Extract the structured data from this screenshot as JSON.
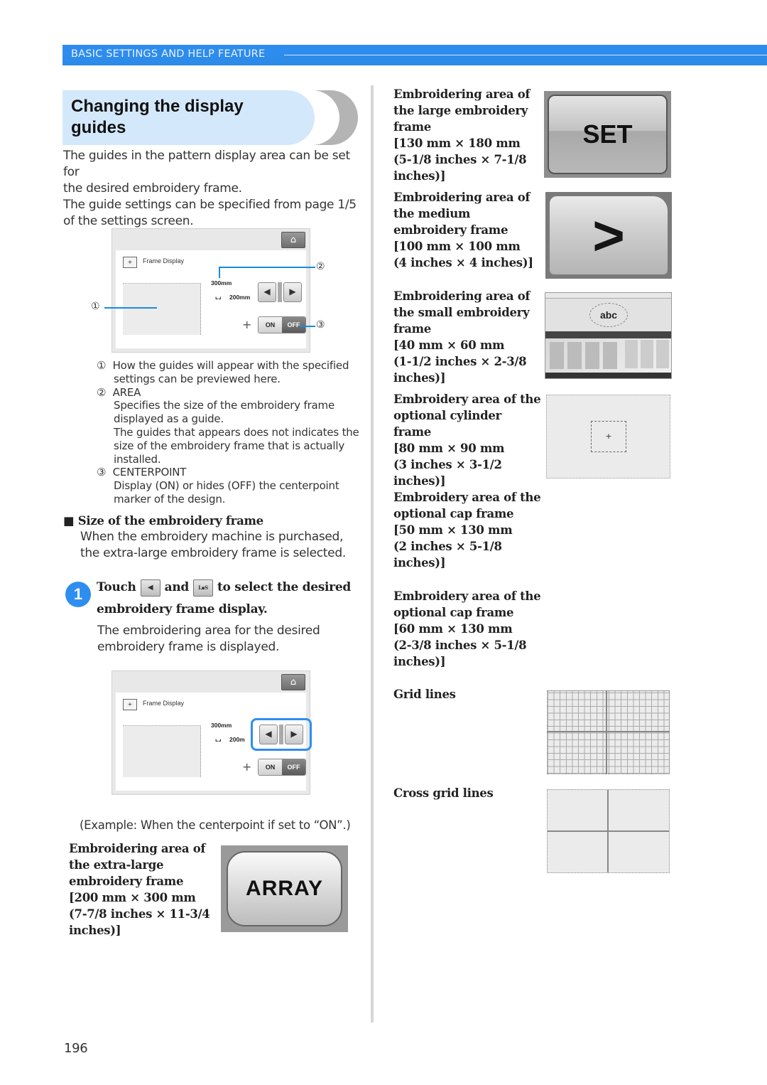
{
  "header": {
    "section": "BASIC SETTINGS AND HELP FEATURE"
  },
  "title": {
    "line1": "Changing the display",
    "line2": "guides"
  },
  "intro": [
    "The guides in the pattern display area can be set for",
    "the desired embroidery frame.",
    "The guide settings can be specified from page 1/5",
    "of the settings screen."
  ],
  "screen1": {
    "home_icon": "home-icon",
    "frame_display_label": "Frame Display",
    "width_label": "300mm",
    "height_label": "200mm",
    "left_arrow": "◀",
    "right_arrow": "▶",
    "plus": "+",
    "on_label": "ON",
    "off_label": "OFF",
    "callout1": "①",
    "callout2": "②",
    "callout3": "③"
  },
  "legend": [
    {
      "num": "①",
      "lines": [
        "How the guides will appear with the specified",
        "settings can be previewed here."
      ]
    },
    {
      "num": "②",
      "lines": [
        "AREA",
        "Specifies the size of the embroidery frame",
        "displayed as a guide.",
        "The guides that appears does not indicates the",
        "size of the embroidery frame that is actually",
        "installed."
      ]
    },
    {
      "num": "③",
      "lines": [
        "CENTERPOINT",
        "Display (ON) or hides (OFF) the centerpoint",
        "marker of the design."
      ]
    }
  ],
  "size_section": {
    "bullet": "■",
    "heading": "Size of the embroidery frame",
    "lines": [
      "When the embroidery machine is purchased,",
      "the extra-large embroidery frame is selected."
    ]
  },
  "step1": {
    "number": "1",
    "touch": "Touch",
    "and": "and",
    "rest": "to select the desired",
    "line2": "embroidery frame display.",
    "icon1": "◀",
    "icon2": "L▪S",
    "desc": [
      "The embroidering area for the desired",
      "embroidery frame is displayed."
    ]
  },
  "screen2": {
    "frame_display_label": "Frame Display",
    "width_label": "300mm",
    "height_label": "200m",
    "left_arrow": "◀",
    "right_arrow": "▶",
    "plus": "+",
    "on_label": "ON",
    "off_label": "OFF"
  },
  "example_caption": "(Example: When the centerpoint if set to “ON”.)",
  "frames": [
    {
      "lines": [
        "Embroidering area of",
        "the extra-large",
        "embroidery frame",
        "[200 mm × 300 mm",
        "(7-7/8 inches × 11-3/4",
        "inches)]"
      ],
      "image_label": "ARRAY"
    },
    {
      "lines": [
        "Embroidering area of",
        "the large embroidery",
        "frame",
        "[130 mm × 180 mm",
        "(5-1/8 inches × 7-1/8",
        "inches)]"
      ],
      "image_label": "SET"
    },
    {
      "lines": [
        "Embroidering area of",
        "the medium",
        "embroidery frame",
        "[100 mm × 100 mm",
        "(4 inches × 4 inches)]"
      ],
      "image_label": ">"
    },
    {
      "lines": [
        "Embroidering area of",
        "the small embroidery",
        "frame",
        "[40 mm × 60 mm",
        "(1-1/2 inches × 2-3/8",
        "inches)]"
      ],
      "image_label": "abc"
    },
    {
      "lines": [
        "Embroidery area of the",
        "optional cylinder frame",
        "[80 mm × 90 mm",
        "(3 inches × 3-1/2",
        "inches)]"
      ],
      "image_label": "+"
    },
    {
      "lines": [
        "Embroidery area of the",
        "optional cap frame",
        "[50 mm × 130 mm",
        "(2 inches × 5-1/8",
        "inches)]"
      ]
    },
    {
      "lines": [
        "Embroidery area of the",
        "optional cap frame",
        "[60 mm × 130 mm",
        "(2-3/8 inches × 5-1/8",
        "inches)]"
      ]
    }
  ],
  "grid_lines_label": "Grid lines",
  "cross_grid_label": "Cross grid lines",
  "page_number": "196"
}
